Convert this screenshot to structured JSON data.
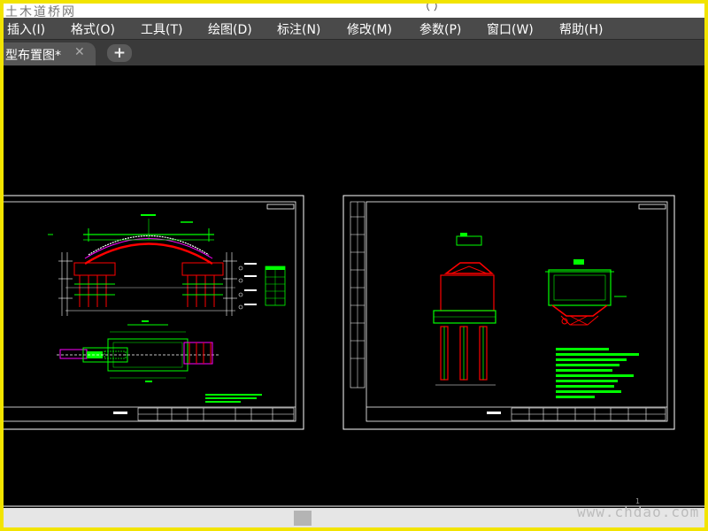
{
  "app": {
    "logo_text": "土木道桥网",
    "title_text": "（ ）"
  },
  "menu": {
    "items": [
      {
        "label": "插入(I)"
      },
      {
        "label": "格式(O)"
      },
      {
        "label": "工具(T)"
      },
      {
        "label": "绘图(D)"
      },
      {
        "label": "标注(N)"
      },
      {
        "label": "修改(M)"
      },
      {
        "label": "参数(P)"
      },
      {
        "label": "窗口(W)"
      },
      {
        "label": "帮助(H)"
      }
    ]
  },
  "tabs": {
    "active_label": "型布置图*",
    "close_icon": "close-icon",
    "add_label": "+"
  },
  "drawing": {
    "background": "#000000",
    "colors": {
      "green": "#00ff00",
      "red": "#ff0000",
      "magenta": "#ff00ff",
      "white": "#ffffff",
      "cyan": "#00ffff",
      "yellow": "#ffff00"
    }
  },
  "status": {
    "watermark": "www.chdao.com",
    "page_marker": "1"
  }
}
